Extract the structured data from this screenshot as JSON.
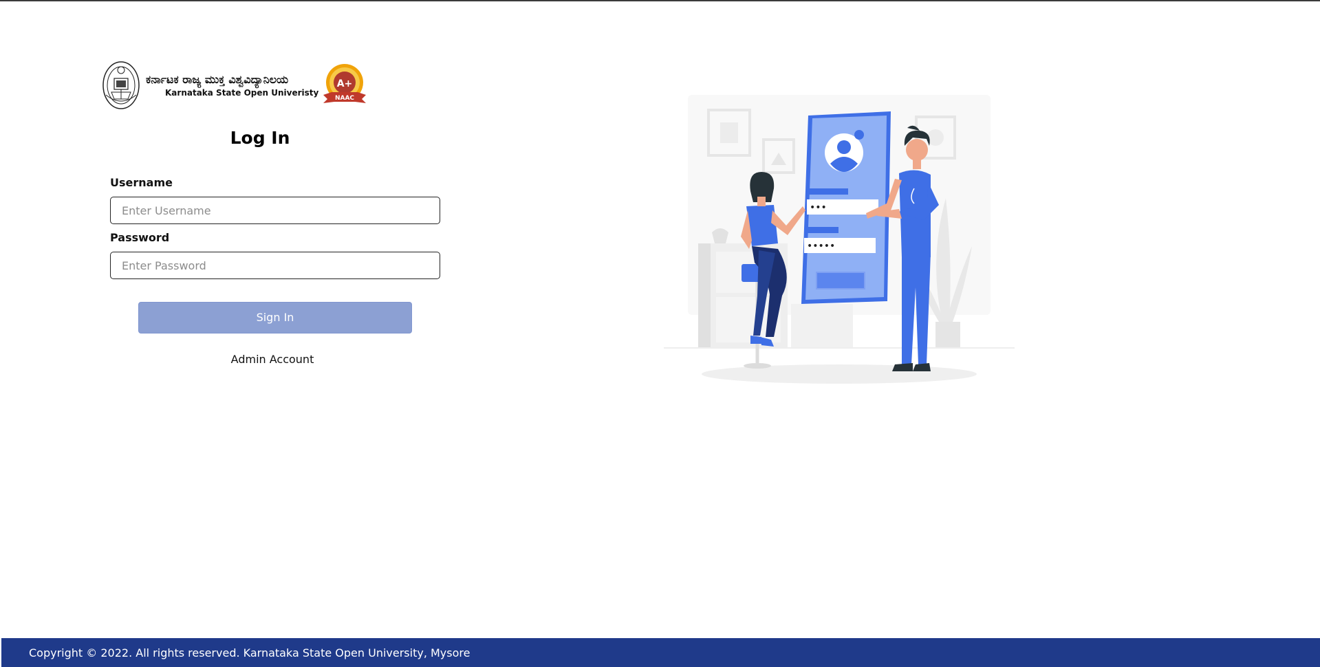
{
  "brand": {
    "name_kannada": "ಕರ್ನಾಟಕ ರಾಜ್ಯ ಮುಕ್ತ ವಿಶ್ವವಿದ್ಯಾನಿಲಯ",
    "name_english": "Karnataka State Open Univeristy",
    "naac_grade": "A+",
    "naac_label": "NAAC"
  },
  "login": {
    "title": "Log In",
    "username_label": "Username",
    "username_placeholder": "Enter Username",
    "username_value": "",
    "password_label": "Password",
    "password_placeholder": "Enter Password",
    "password_value": "",
    "signin_label": "Sign In",
    "admin_link": "Admin Account"
  },
  "illustration": {
    "masked_field_1": "•••",
    "masked_field_2": "•••••"
  },
  "footer": {
    "copyright": "Copyright © 2022. All rights reserved. Karnataka State Open University, Mysore"
  },
  "colors": {
    "footer_bg": "#1f3a8a",
    "signin_bg": "#8ca0d3",
    "illustration_blue": "#3f6fe6",
    "illustration_light_blue": "#8fb0f5",
    "naac_red": "#c0392b",
    "naac_gold": "#f0a30a"
  }
}
